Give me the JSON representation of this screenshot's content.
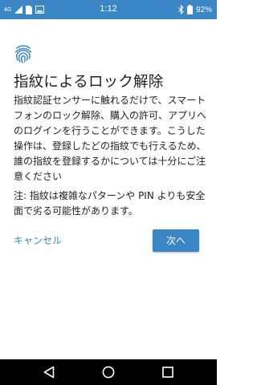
{
  "status_bar": {
    "network": "4G",
    "time": "1:12",
    "battery_percent": "92%"
  },
  "dialog": {
    "title": "指紋によるロック解除",
    "body": "指紋認証センサーに触れるだけで、スマートフォンのロック解除、購入の許可、アプリへのログインを行うことができます。こうした操作は、登録したどの指紋でも行えるため、誰の指紋を登録するかについては十分にご注意ください",
    "note": "注: 指紋は複雑なパターンや PIN よりも安全面で劣る可能性があります。",
    "cancel_label": "キャンセル",
    "next_label": "次へ"
  },
  "colors": {
    "accent": "#3b86c7",
    "status_bar": "#3b86c7",
    "nav_bar": "#000000",
    "background": "#ffffff"
  },
  "icons": {
    "status_left": [
      "signal-icon",
      "sim-icon",
      "image-icon"
    ],
    "status_right": [
      "bluetooth-icon",
      "battery-icon"
    ],
    "content": "fingerprint-icon",
    "nav": [
      "back-icon",
      "home-icon",
      "recents-icon"
    ]
  }
}
